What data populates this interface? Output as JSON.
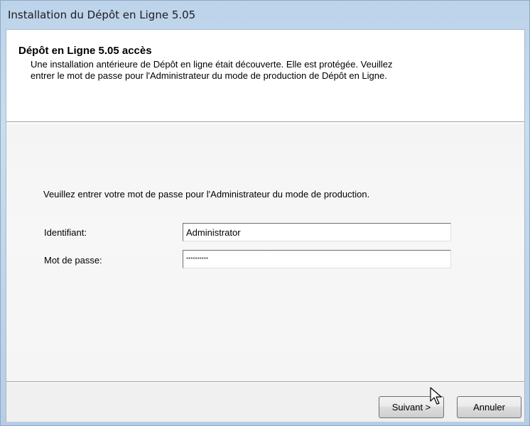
{
  "window": {
    "title": "Installation du Dépôt en Ligne 5.05"
  },
  "header": {
    "title": "Dépôt en Ligne 5.05 accès",
    "description": "Une installation antérieure de Dépôt en ligne était découverte. Elle est protégée. Veuillez entrer le mot de passe pour l'Administrateur du mode de production de Dépôt en Ligne."
  },
  "form": {
    "instruction": "Veuillez entrer votre mot de passe pour l'Administrateur du mode de production.",
    "identifiant_label": "Identifiant:",
    "identifiant_value": "Administrator",
    "password_label": "Mot de passe:",
    "password_value": "**********"
  },
  "footer": {
    "next_label": "Suivant >",
    "cancel_label": "Annuler"
  },
  "icons": {
    "cursor": "arrow-cursor-icon"
  }
}
